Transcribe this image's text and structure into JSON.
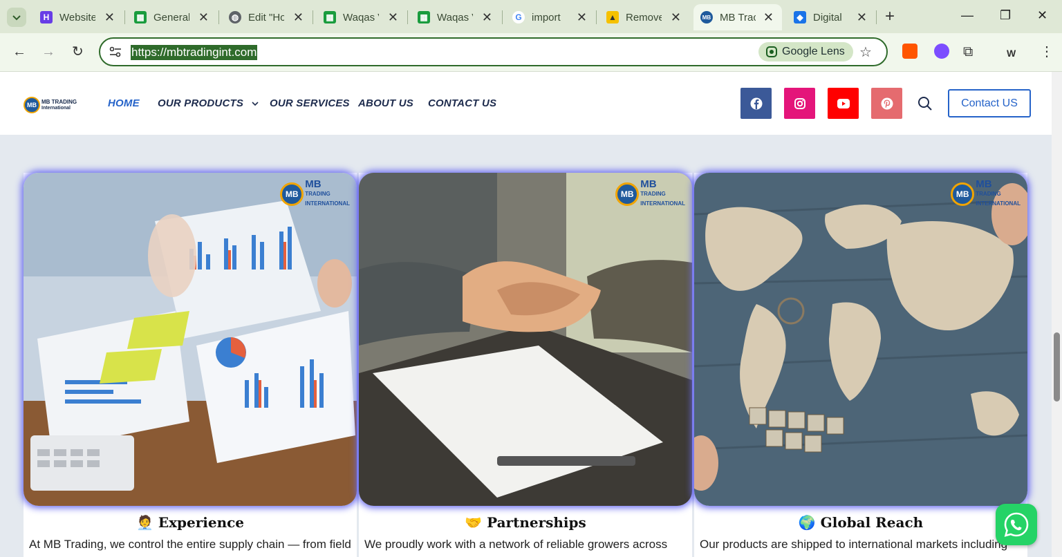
{
  "browser": {
    "tabs": [
      {
        "title": "Website",
        "favicon": "hostinger-icon",
        "color": "#673de6"
      },
      {
        "title": "General",
        "favicon": "spreadsheet-icon",
        "color": "#1a9c3e"
      },
      {
        "title": "Edit \"Ho",
        "favicon": "globe-icon",
        "color": "#5f6368"
      },
      {
        "title": "Waqas V",
        "favicon": "spreadsheet-icon",
        "color": "#1a9c3e"
      },
      {
        "title": "Waqas V",
        "favicon": "spreadsheet-icon",
        "color": "#1a9c3e"
      },
      {
        "title": "import",
        "favicon": "google-icon",
        "color": "#4285f4"
      },
      {
        "title": "Remove",
        "favicon": "remove-bg-icon",
        "color": "#f6c100"
      },
      {
        "title": "MB Trac",
        "favicon": "mb-trading-icon",
        "color": "#1f5a9c"
      },
      {
        "title": "Digital",
        "favicon": "digital-icon",
        "color": "#1a73e8"
      }
    ],
    "url": "https://mbtradingint.com",
    "lens_label": "Google Lens"
  },
  "site": {
    "logo_text_1": "MB TRADING",
    "logo_text_2": "International",
    "logo_badge": "MB",
    "nav": {
      "home": "HOME",
      "products": "OUR PRODUCTS",
      "services": "OUR SERVICES",
      "about": "ABOUT US",
      "contact": "CONTACT US"
    },
    "contact_button": "Contact US",
    "social_colors": {
      "facebook": "#3b5998",
      "instagram": "#e4157a",
      "youtube": "#ff0000",
      "pinterest": "#e56b6f"
    }
  },
  "cards": [
    {
      "emoji": "🧑‍💼",
      "title": "Experience",
      "text": "At MB Trading, we control the entire supply chain — from field",
      "image": "business-charts-photo"
    },
    {
      "emoji": "🤝",
      "title": "Partnerships",
      "text": "We proudly work with a network of reliable growers across",
      "image": "handshake-photo"
    },
    {
      "emoji": "🌍",
      "title": "Global Reach",
      "text": "Our products are shipped to international markets including",
      "image": "world-map-photo"
    }
  ],
  "image_logo": {
    "badge": "MB",
    "line1": "MB",
    "line2": "TRADING",
    "line3": "INTERNATIONAL"
  }
}
